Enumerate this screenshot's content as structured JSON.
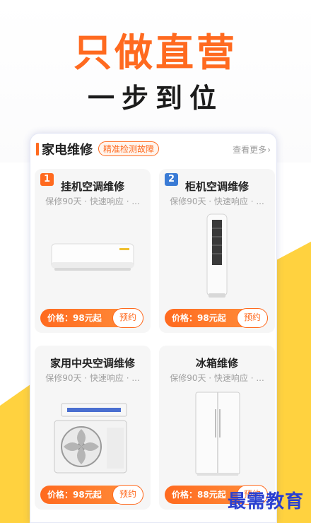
{
  "hero": {
    "headline": "只做直营",
    "subline": "一步到位"
  },
  "section": {
    "title": "家电维修",
    "tag": "精准检测故障",
    "more": "查看更多",
    "more_icon": "chevron-right-icon"
  },
  "items": [
    {
      "rank": "1",
      "rank_color": "#ff6a1f",
      "name": "挂机空调维修",
      "desc": "保修90天 · 快速响应 · ...",
      "price": "价格：98元起",
      "book": "预约",
      "image": "wall-ac-icon"
    },
    {
      "rank": "2",
      "rank_color": "#3a7bd5",
      "name": "柜机空调维修",
      "desc": "保修90天 · 快速响应 · ...",
      "price": "价格：98元起",
      "book": "预约",
      "image": "tower-ac-icon"
    },
    {
      "rank": "",
      "name": "家用中央空调维修",
      "desc": "保修90天 · 快速响应 · ...",
      "price": "价格：98元起",
      "book": "预约",
      "image": "central-ac-icon"
    },
    {
      "rank": "",
      "name": "冰箱维修",
      "desc": "保修90天 · 快速响应 · ...",
      "price": "价格：88元起",
      "book": "预约",
      "image": "fridge-icon"
    }
  ],
  "watermark": "最需教育",
  "colors": {
    "accent": "#ff6a1f",
    "yellow": "#ffd23f",
    "rank2": "#3a7bd5"
  }
}
